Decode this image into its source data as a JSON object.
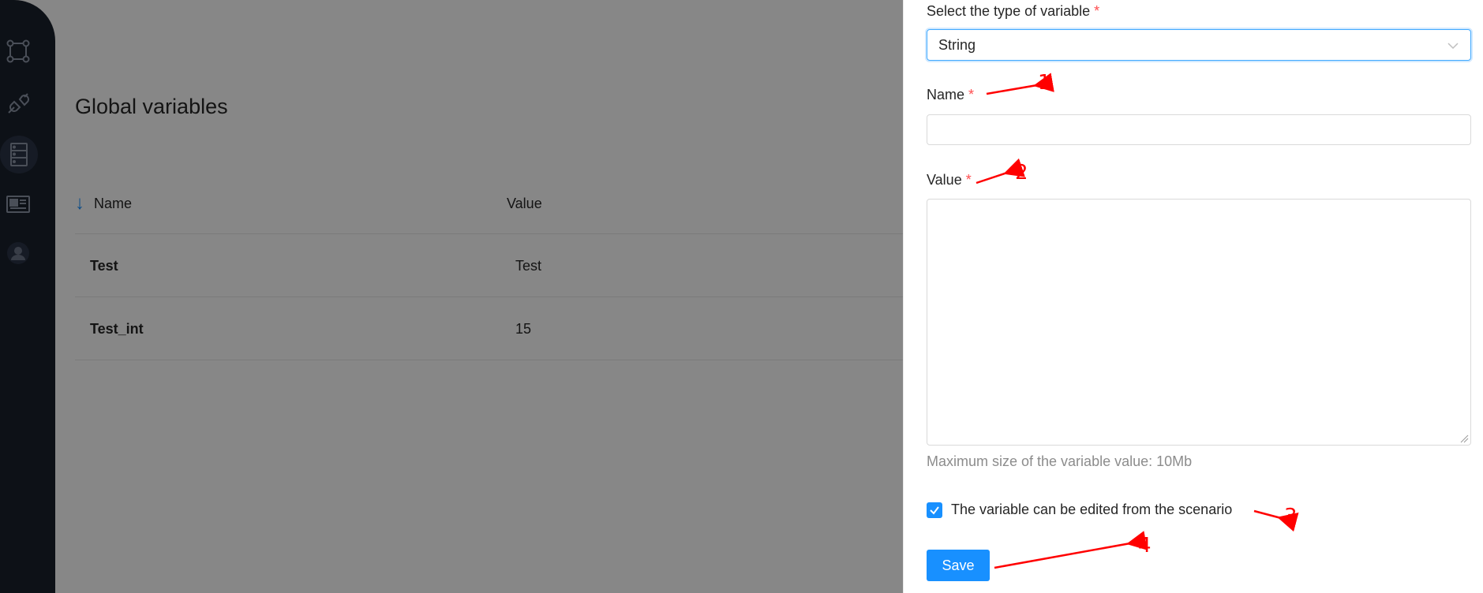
{
  "sidebar": {
    "items": [
      {
        "icon": "workflow-icon"
      },
      {
        "icon": "plug-icon"
      },
      {
        "icon": "server-icon",
        "active": true
      },
      {
        "icon": "newspaper-icon"
      },
      {
        "icon": "user-avatar-icon"
      }
    ]
  },
  "page": {
    "title": "Global variables"
  },
  "table": {
    "columns": [
      "Name",
      "Value"
    ],
    "sort_icon": "sort-down-arrow-icon",
    "rows": [
      {
        "name": "Test",
        "value": "Test"
      },
      {
        "name": "Test_int",
        "value": "15"
      }
    ]
  },
  "drawer": {
    "type_label": "Select the type of variable",
    "type_value": "String",
    "name_label": "Name",
    "name_value": "",
    "value_label": "Value",
    "value_value": "",
    "required_mark": "*",
    "hint": "Maximum size of the variable value: 10Mb",
    "checkbox_label": "The variable can be edited from the scenario",
    "checkbox_checked": true,
    "save_label": "Save"
  },
  "annotations": [
    "1",
    "2",
    "3",
    "4"
  ],
  "colors": {
    "accent": "#1890ff",
    "annotation": "#ff0000",
    "required": "#ff4d4f",
    "sidebar": "#19202c"
  }
}
